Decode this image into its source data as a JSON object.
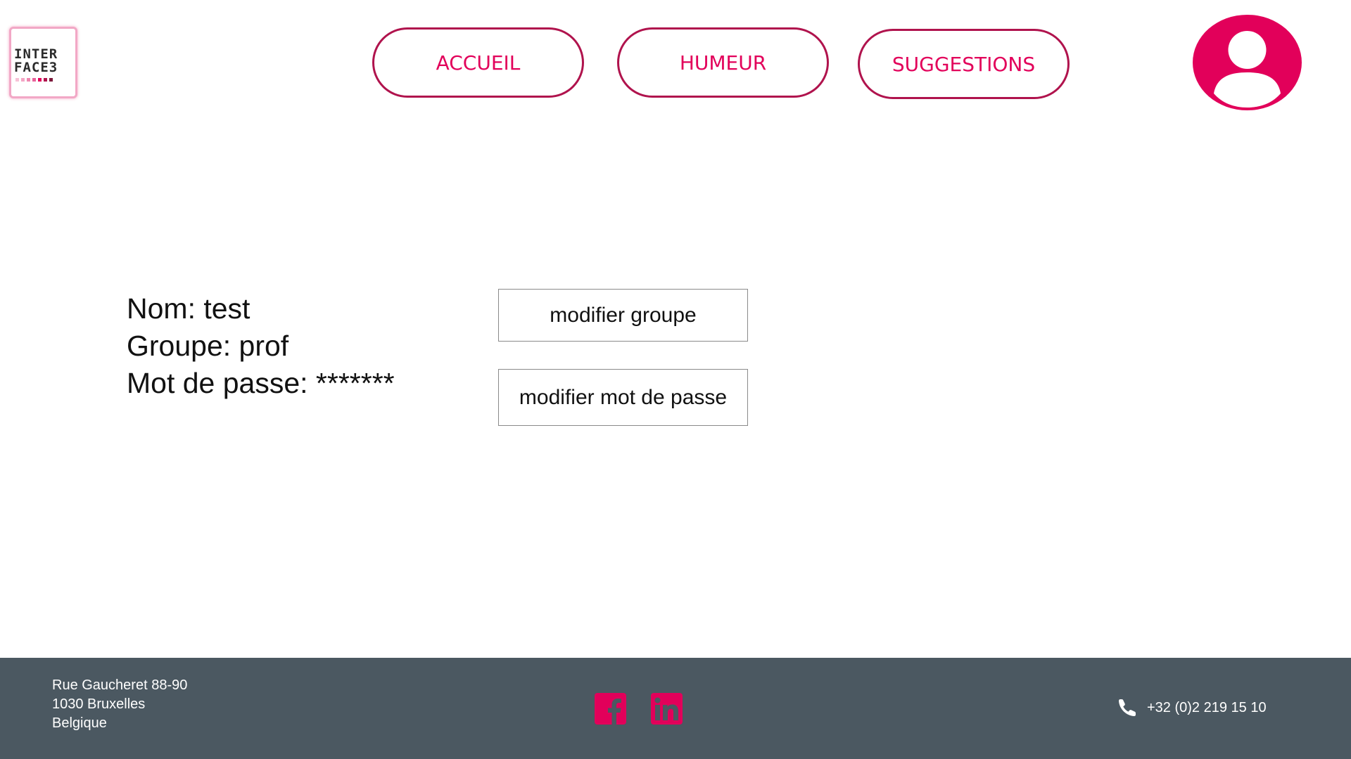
{
  "header": {
    "logo": {
      "line1": "INTER",
      "line2": "FACE3",
      "dot_colors": [
        "#f7c1d6",
        "#f4a6c5",
        "#ef87b0",
        "#e8629a",
        "#e2005a",
        "#b0134d",
        "#7d1a3c"
      ]
    },
    "nav": {
      "accueil": "ACCUEIL",
      "humeur": "HUMEUR",
      "suggestions": "SUGGESTIONS"
    },
    "avatar_icon": "user-account-icon"
  },
  "profile": {
    "nom": "Nom: test",
    "groupe": "Groupe: prof",
    "mot_de_passe": "Mot de passe: *******"
  },
  "actions": {
    "modifier_groupe": "modifier groupe",
    "modifier_mot_de_passe": "modifier mot de passe"
  },
  "footer": {
    "address": {
      "line1": "Rue Gaucheret 88-90",
      "line2": "1030 Bruxelles",
      "line3": "Belgique"
    },
    "social": {
      "facebook_icon": "facebook-icon",
      "linkedin_icon": "linkedin-icon"
    },
    "phone_icon": "phone-icon",
    "phone": "+32 (0)2 219 15 10"
  },
  "colors": {
    "accent": "#e2005a",
    "nav_border": "#b0134d",
    "footer_bg": "#4b5861",
    "text": "#111111"
  }
}
